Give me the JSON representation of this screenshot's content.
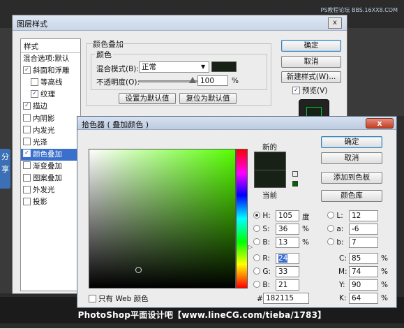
{
  "backdrop": {
    "watermark": "PS教程论坛  BBS.16XX8.COM",
    "share_tab": "分享",
    "bottom_caption": "PhotoShop平面设计吧【www.lineCG.com/tieba/1783】"
  },
  "layer_style": {
    "title": "图层样式",
    "close_glyph": "x",
    "list_header": "样式",
    "list_items": [
      {
        "label": "混合选项:默认",
        "checkbox": false,
        "checked": false,
        "selected": false
      },
      {
        "label": "斜面和浮雕",
        "checkbox": true,
        "checked": true,
        "selected": false
      },
      {
        "label": "等高线",
        "checkbox": true,
        "checked": false,
        "selected": false
      },
      {
        "label": "纹理",
        "checkbox": true,
        "checked": true,
        "selected": false
      },
      {
        "label": "描边",
        "checkbox": true,
        "checked": true,
        "selected": false
      },
      {
        "label": "内阴影",
        "checkbox": true,
        "checked": false,
        "selected": false
      },
      {
        "label": "内发光",
        "checkbox": true,
        "checked": false,
        "selected": false
      },
      {
        "label": "光泽",
        "checkbox": true,
        "checked": false,
        "selected": false
      },
      {
        "label": "颜色叠加",
        "checkbox": true,
        "checked": true,
        "selected": true
      },
      {
        "label": "渐变叠加",
        "checkbox": true,
        "checked": false,
        "selected": false
      },
      {
        "label": "图案叠加",
        "checkbox": true,
        "checked": false,
        "selected": false
      },
      {
        "label": "外发光",
        "checkbox": true,
        "checked": false,
        "selected": false
      },
      {
        "label": "投影",
        "checkbox": true,
        "checked": false,
        "selected": false
      }
    ],
    "section_title": "颜色叠加",
    "group_title": "颜色",
    "blend_mode_label": "混合模式(B):",
    "blend_mode_value": "正常",
    "overlay_color": "#182115",
    "opacity_label": "不透明度(O):",
    "opacity_value": "100",
    "opacity_unit": "%",
    "opacity_fraction": 1.0,
    "set_default_button": "设置为默认值",
    "reset_default_button": "复位为默认值",
    "ok_button": "确定",
    "cancel_button": "取消",
    "new_style_button": "新建样式(W)...",
    "preview_label": "预览(V)",
    "preview_checked": true
  },
  "color_picker": {
    "title": "拾色器 ( 叠加颜色 )",
    "close_glyph": "x",
    "new_label": "新的",
    "current_label": "当前",
    "new_color": "#182115",
    "current_color": "#182115",
    "ok_button": "确定",
    "cancel_button": "取消",
    "add_swatch_button": "添加到色板",
    "color_libraries_button": "颜色库",
    "web_only_label": "只有 Web 颜色",
    "web_only_checked": false,
    "fields": {
      "H": {
        "label": "H:",
        "value": "105",
        "unit": "度",
        "selected": true
      },
      "S": {
        "label": "S:",
        "value": "36",
        "unit": "%",
        "selected": false
      },
      "B": {
        "label": "B:",
        "value": "13",
        "unit": "%",
        "selected": false
      },
      "R": {
        "label": "R:",
        "value": "24",
        "selected": false
      },
      "G": {
        "label": "G:",
        "value": "33",
        "selected": false
      },
      "Bl": {
        "label": "B:",
        "value": "21",
        "selected": false
      },
      "L": {
        "label": "L:",
        "value": "12",
        "selected": false
      },
      "a": {
        "label": "a:",
        "value": "-6",
        "selected": false
      },
      "b": {
        "label": "b:",
        "value": "7",
        "selected": false
      },
      "C": {
        "label": "C:",
        "value": "85",
        "unit": "%"
      },
      "M": {
        "label": "M:",
        "value": "74",
        "unit": "%"
      },
      "Y": {
        "label": "Y:",
        "value": "90",
        "unit": "%"
      },
      "K": {
        "label": "K:",
        "value": "64",
        "unit": "%"
      }
    },
    "hex_label": "#",
    "hex_value": "182115"
  }
}
